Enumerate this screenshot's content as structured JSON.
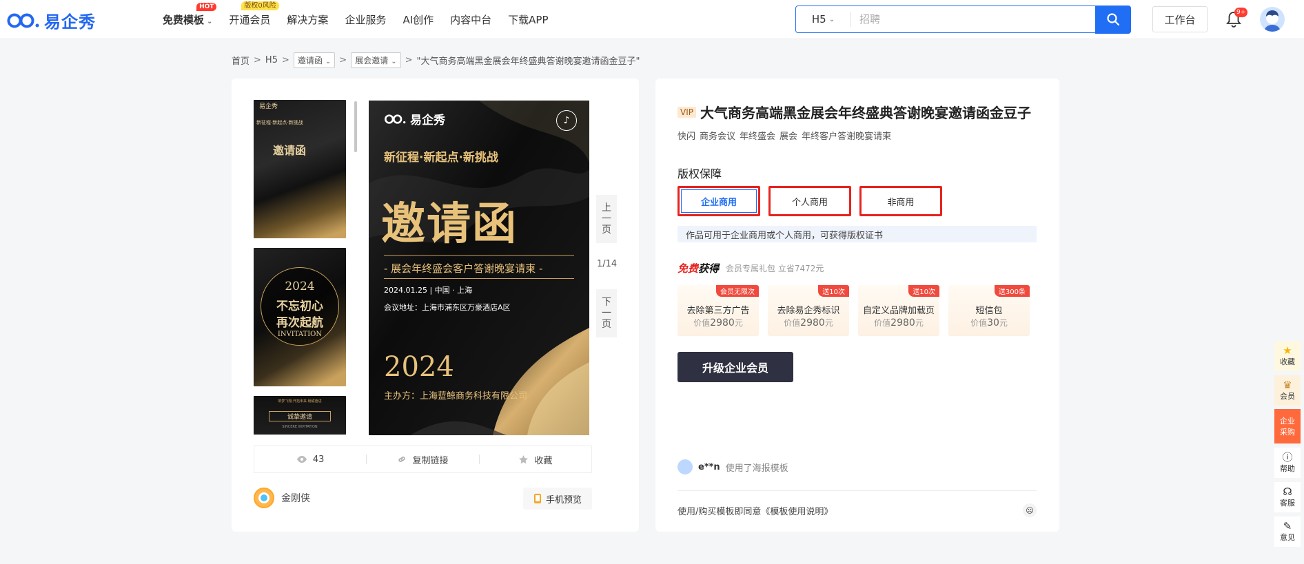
{
  "logo": {
    "text": "易企秀"
  },
  "nav": {
    "items": [
      {
        "label": "免费模板",
        "badge": "HOT"
      },
      {
        "label": "开通会员",
        "badge": "版权0风险"
      },
      {
        "label": "解决方案"
      },
      {
        "label": "企业服务"
      },
      {
        "label": "AI创作"
      },
      {
        "label": "内容中台"
      },
      {
        "label": "下载APP"
      }
    ]
  },
  "search": {
    "type": "H5",
    "placeholder": "招聘"
  },
  "header": {
    "workbench": "工作台",
    "notif_count": "9+"
  },
  "breadcrumb": {
    "home": "首页",
    "h5": "H5",
    "cat1": "邀请函",
    "cat2": "展会邀请",
    "current": "\"大气商务高端黑金展会年终盛典答谢晚宴邀请函金豆子\""
  },
  "poster": {
    "brand": "易企秀",
    "slogan": "新征程·新起点·新挑战",
    "headline": "邀请函",
    "subhead": "- 展会年终盛会客户答谢晚宴请柬 -",
    "date": "2024.01.25 | 中国 · 上海",
    "address": "会议地址：上海市浦东区万豪酒店A区",
    "year": "2024",
    "host": "主办方：上海蓝鲸商务科技有限公司"
  },
  "thumbs": [
    {
      "brand": "易企秀",
      "line": "新征程·新起点·新挑战",
      "title": "邀请函"
    },
    {
      "year": "2024",
      "line1": "不忘初心",
      "line2": "再次起航",
      "sub": "INVITATION"
    },
    {
      "line": "筑梦飞翔·开拓未来·砥砺奋进",
      "title": "诚挚邀请",
      "sub": "SINCERE INVITATION"
    }
  ],
  "pager": {
    "prev": [
      "上",
      "一",
      "页"
    ],
    "current": "1/14",
    "next": [
      "下",
      "一",
      "页"
    ]
  },
  "stats": {
    "views": "43",
    "copy_link": "复制链接",
    "favorite": "收藏"
  },
  "author": {
    "name": "金刚侠"
  },
  "mobile_preview": "手机预览",
  "detail": {
    "vip": "VIP",
    "title": "大气商务高端黑金展会年终盛典答谢晚宴邀请函金豆子",
    "tags": [
      "快闪",
      "商务会议",
      "年终盛会",
      "展会",
      "年终客户答谢晚宴请柬"
    ]
  },
  "license": {
    "heading": "版权保障",
    "options": [
      "企业商用",
      "个人商用",
      "非商用"
    ],
    "selected": "企业商用",
    "note": "作品可用于企业商用或个人商用，可获得版权证书"
  },
  "free": {
    "logo_a": "免费",
    "logo_b": "获得",
    "subtitle": "会员专属礼包 立省7472元",
    "perks": [
      {
        "badge": "会员无限次",
        "name": "去除第三方广告",
        "price_prefix": "价值",
        "price": "2980",
        "unit": "元"
      },
      {
        "badge": "送10次",
        "name": "去除易企秀标识",
        "price_prefix": "价值",
        "price": "2980",
        "unit": "元"
      },
      {
        "badge": "送10次",
        "name": "自定义品牌加载页",
        "price_prefix": "价值",
        "price": "2980",
        "unit": "元"
      },
      {
        "badge": "送300条",
        "name": "短信包",
        "price_prefix": "价值",
        "price": "30",
        "unit": "元"
      }
    ]
  },
  "upgrade_button": "升级企业会员",
  "activity": {
    "user": "e**n",
    "action": "使用了海报模板"
  },
  "agreement": "使用/购买模板即同意《模板使用说明》",
  "float_bar": {
    "favorite": "收藏",
    "member": "会员",
    "enterprise": [
      "企业",
      "采购"
    ],
    "help": "帮助",
    "service": "客服",
    "feedback": "意见"
  },
  "colors": {
    "brand": "#1f6ef4",
    "highlight_border": "#e8231e",
    "upgrade_bg": "#2f3041",
    "gold": "#e8c27a"
  }
}
